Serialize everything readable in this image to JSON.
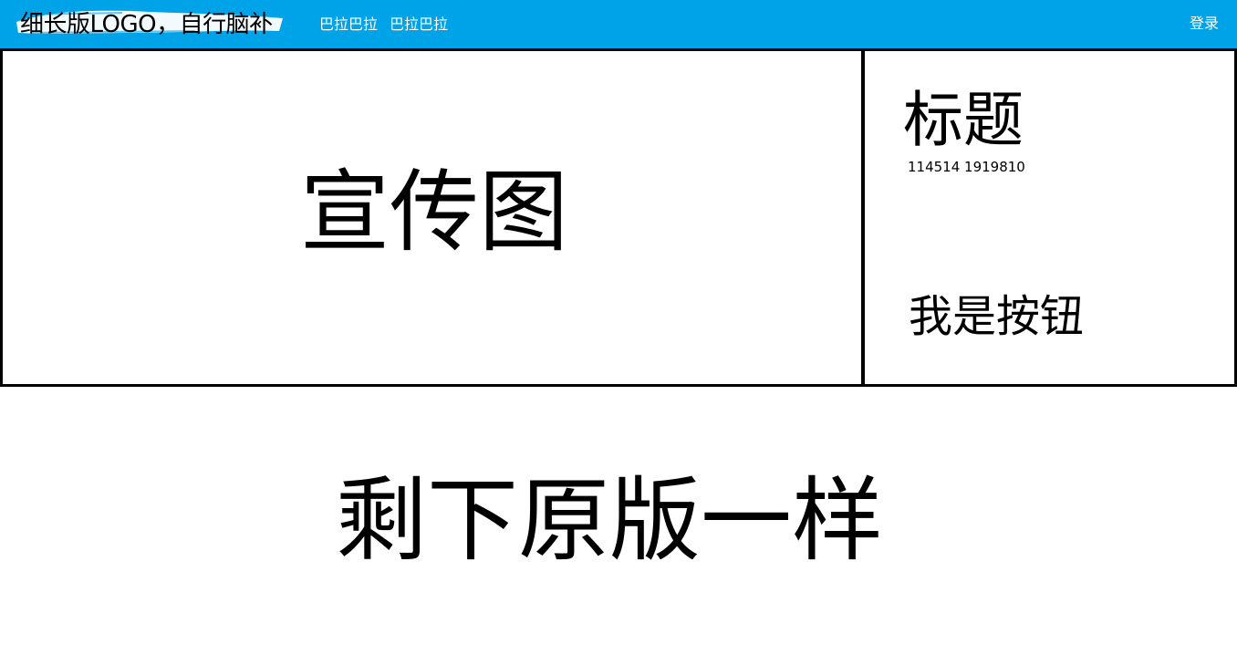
{
  "header": {
    "logo_text": "细长版LOGO，自行脑补",
    "nav": [
      "巴拉巴拉",
      "巴拉巴拉"
    ],
    "login_label": "登录",
    "background": "#00a2e8"
  },
  "banner": {
    "text": "宣传图"
  },
  "side": {
    "title": "标题",
    "subtitle": "114514 1919810",
    "button_label": "我是按钮"
  },
  "footer": {
    "text": "剩下原版一样"
  }
}
